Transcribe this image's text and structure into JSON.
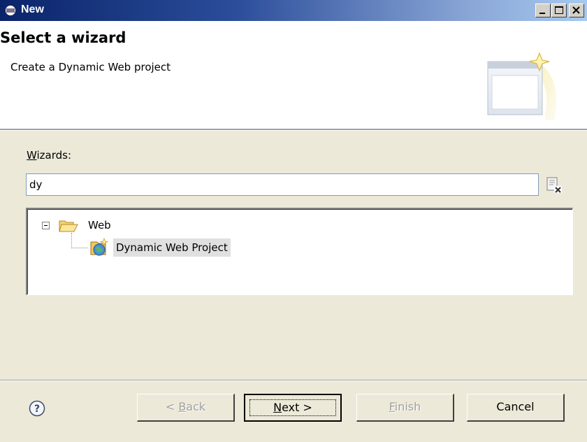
{
  "window": {
    "title": "New",
    "icon": "eclipse-icon"
  },
  "titlebar_buttons": {
    "minimize_icon": "minimize-icon",
    "maximize_icon": "maximize-icon",
    "close_icon": "close-icon"
  },
  "banner": {
    "title": "Select a wizard",
    "description": "Create a Dynamic Web project",
    "image": "new-wizard-banner-icon"
  },
  "wizards": {
    "label_prefix": "",
    "label_mnemonic": "W",
    "label_rest": "izards:",
    "filter_value": "dy",
    "clear_icon": "clear-filter-icon"
  },
  "tree": {
    "items": [
      {
        "label": "Web",
        "icon": "folder-open-icon",
        "expanded": true
      },
      {
        "label": "Dynamic Web Project",
        "icon": "dynamic-web-project-icon",
        "selected": true
      }
    ]
  },
  "footer": {
    "help_icon": "help-icon",
    "back": {
      "prefix": "< ",
      "mnemonic": "B",
      "rest": "ack",
      "enabled": false
    },
    "next": {
      "prefix": "",
      "mnemonic": "N",
      "rest": "ext >",
      "enabled": true
    },
    "finish": {
      "prefix": "",
      "mnemonic": "F",
      "rest": "inish",
      "enabled": false
    },
    "cancel": {
      "label": "Cancel",
      "enabled": true
    }
  },
  "colors": {
    "titlebar_start": "#0a246a",
    "titlebar_end": "#a6caf0",
    "dialog_bg": "#ece9d8",
    "selection_bg": "#e0e0e0"
  }
}
